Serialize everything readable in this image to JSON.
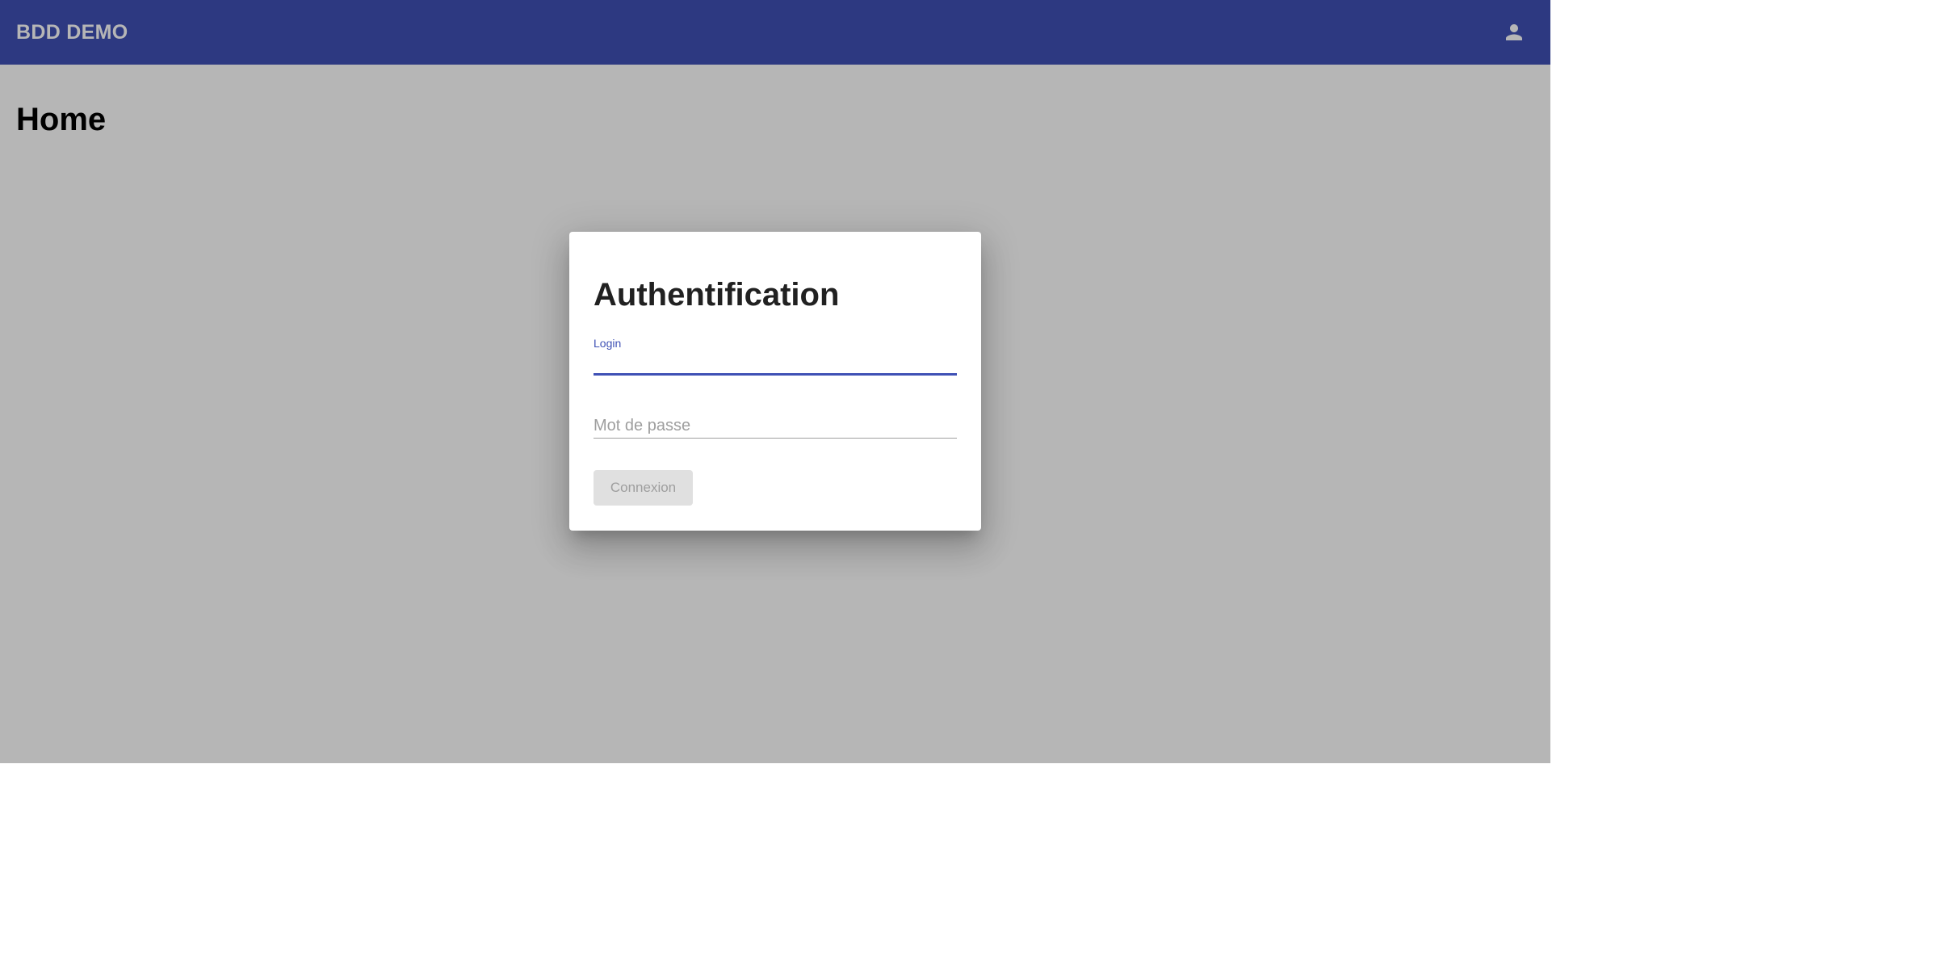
{
  "toolbar": {
    "app_title": "BDD DEMO",
    "user_icon": "person-icon"
  },
  "page": {
    "title": "Home"
  },
  "dialog": {
    "title": "Authentification",
    "login": {
      "label": "Login",
      "value": ""
    },
    "password": {
      "placeholder": "Mot de passe",
      "value": ""
    },
    "submit_label": "Connexion",
    "submit_disabled": true
  },
  "colors": {
    "primary": "#3f51b5",
    "backdrop": "#b6b6b6",
    "disabled_button_bg": "#e0e0e0",
    "disabled_button_text": "#9e9e9e"
  }
}
